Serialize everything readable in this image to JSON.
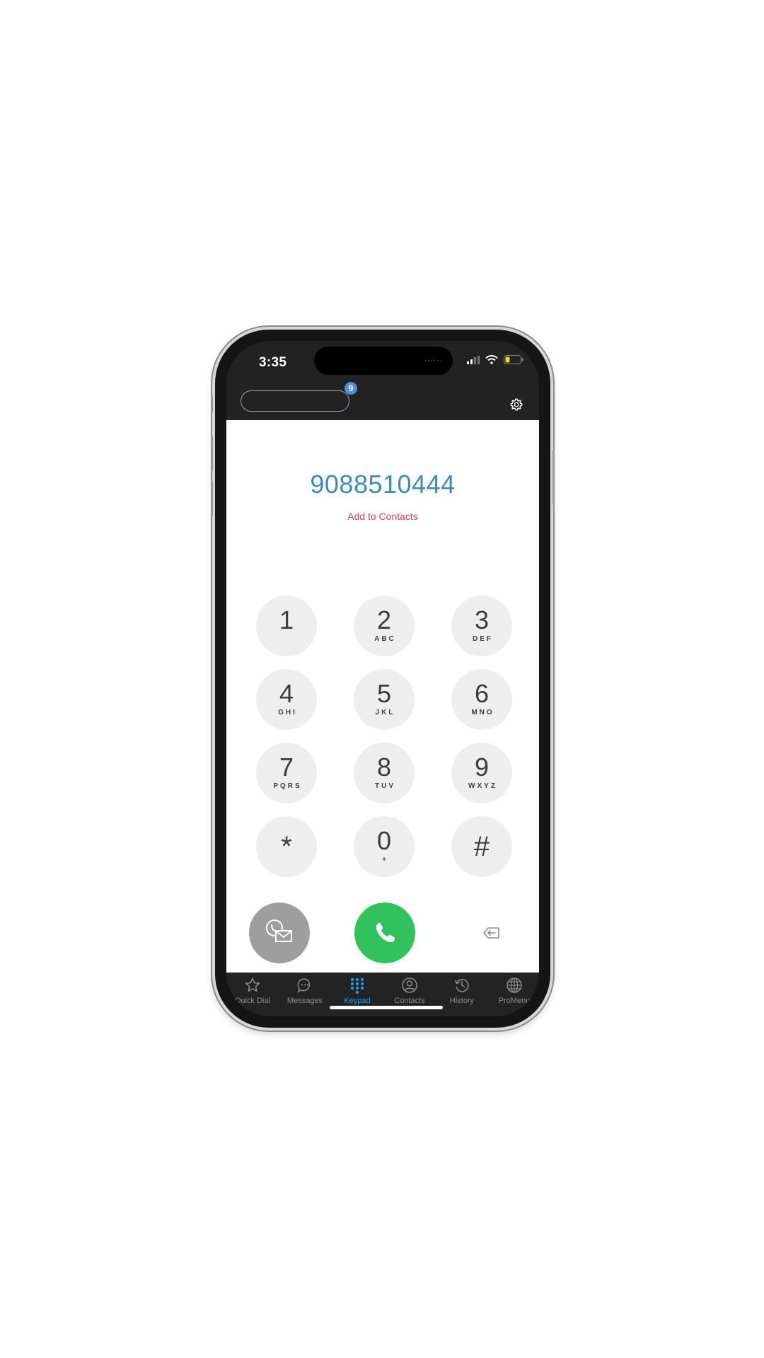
{
  "status": {
    "time": "3:35"
  },
  "header": {
    "badge_count": "9"
  },
  "dial": {
    "number": "9088510444",
    "add_contact_label": "Add to Contacts"
  },
  "keypad": [
    {
      "digit": "1",
      "letters": ""
    },
    {
      "digit": "2",
      "letters": "ABC"
    },
    {
      "digit": "3",
      "letters": "DEF"
    },
    {
      "digit": "4",
      "letters": "GHI"
    },
    {
      "digit": "5",
      "letters": "JKL"
    },
    {
      "digit": "6",
      "letters": "MNO"
    },
    {
      "digit": "7",
      "letters": "PQRS"
    },
    {
      "digit": "8",
      "letters": "TUV"
    },
    {
      "digit": "9",
      "letters": "WXYZ"
    },
    {
      "digit": "*",
      "letters": ""
    },
    {
      "digit": "0",
      "letters": "+"
    },
    {
      "digit": "#",
      "letters": ""
    }
  ],
  "tabs": [
    {
      "label": "Quick Dial",
      "icon": "star-icon"
    },
    {
      "label": "Messages",
      "icon": "chat-bubble-icon"
    },
    {
      "label": "Keypad",
      "icon": "keypad-grid-icon",
      "active": true
    },
    {
      "label": "Contacts",
      "icon": "person-circle-icon"
    },
    {
      "label": "History",
      "icon": "history-clock-icon"
    },
    {
      "label": "ProMenu",
      "icon": "globe-icon"
    }
  ],
  "colors": {
    "number": "#3a8bb6",
    "add_contact": "#d44355",
    "call_button": "#31c15d",
    "active_tab": "#1d9bf0",
    "badge": "#4f8fd6"
  }
}
